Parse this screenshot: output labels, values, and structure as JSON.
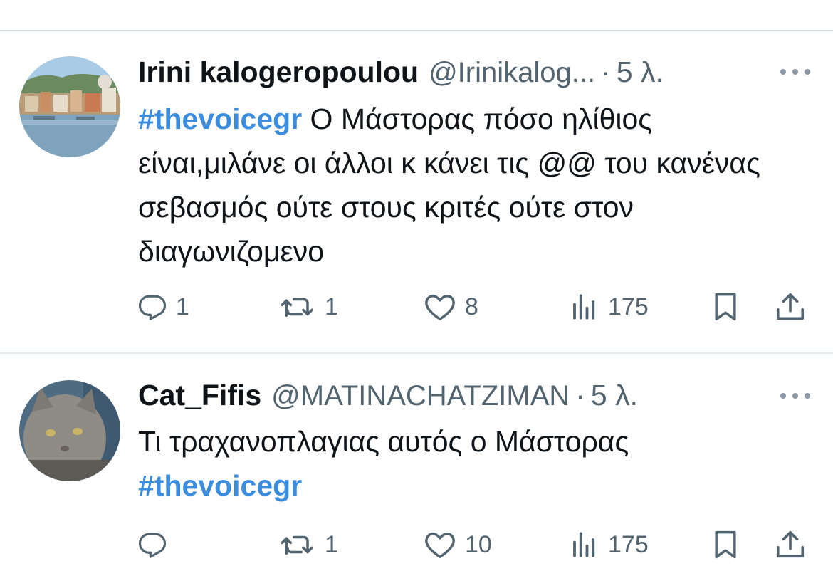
{
  "tweets": [
    {
      "name": "Irini kalogeropoulou",
      "handle": "@Irinikalog...",
      "separator": "·",
      "time": "5 λ.",
      "hashtag": "#thevoicegr",
      "text": " Ο Μάστορας πόσο ηλίθιος είναι,μιλάνε οι άλλοι κ κάνει τις @@ του κανένας σεβασμός ούτε στους κριτές ούτε στον διαγωνιζομενο",
      "replies": "1",
      "retweets": "1",
      "likes": "8",
      "views": "175",
      "avatar_colors": [
        "#9fc4e4",
        "#5e7d5a",
        "#caa37b",
        "#7a9fb8"
      ]
    },
    {
      "name": "Cat_Fifis",
      "handle": "@MATINACHATZIMAN",
      "separator": "·",
      "time": "5 λ.",
      "text": "Τι τραχανοπλαγιας αυτός ο Μάστορας",
      "hashtag": "#thevoicegr",
      "replies": "",
      "retweets": "1",
      "likes": "10",
      "views": "175",
      "avatar_colors": [
        "#4a6b86",
        "#8d8f8f",
        "#6f6a62"
      ]
    }
  ],
  "colors": {
    "hashtag": "#3b8de0",
    "secondary_text": "#536471",
    "primary_text": "#0f1419",
    "divider": "#e6ebef"
  },
  "icons": [
    "reply-icon",
    "retweet-icon",
    "like-icon",
    "views-icon",
    "bookmark-icon",
    "share-icon",
    "more-icon"
  ]
}
